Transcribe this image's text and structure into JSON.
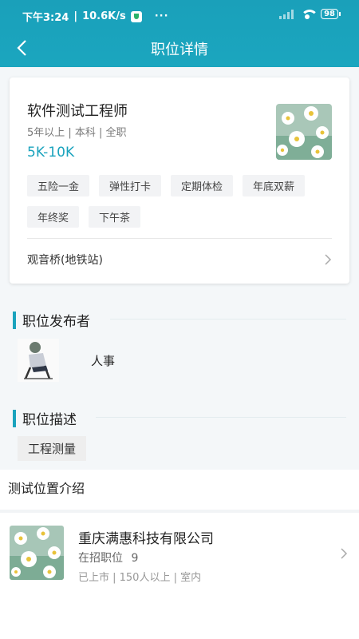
{
  "status_bar": {
    "time": "下午3:24",
    "network_speed": "10.6K/s",
    "more": "···",
    "battery": "98"
  },
  "header": {
    "title": "职位详情",
    "back_icon": "back-arrow-icon"
  },
  "job": {
    "title": "软件测试工程师",
    "meta": "5年以上 | 本科 | 全职",
    "salary": "5K-10K",
    "tags": [
      "五险一金",
      "弹性打卡",
      "定期体检",
      "年底双薪",
      "年终奖",
      "下午茶"
    ],
    "location": "观音桥(地铁站)"
  },
  "publisher_section": {
    "title": "职位发布者",
    "name": "人事"
  },
  "description_section": {
    "title": "职位描述",
    "tag": "工程测量"
  },
  "intro": {
    "title": "测试位置介绍"
  },
  "company": {
    "name": "重庆满惠科技有限公司",
    "jobs_label": "在招职位",
    "jobs_count": "9",
    "info": "已上市 | 150人以上 | 室内"
  },
  "colors": {
    "accent": "#1aa3bd",
    "header_bg": "#1ba6bf"
  }
}
